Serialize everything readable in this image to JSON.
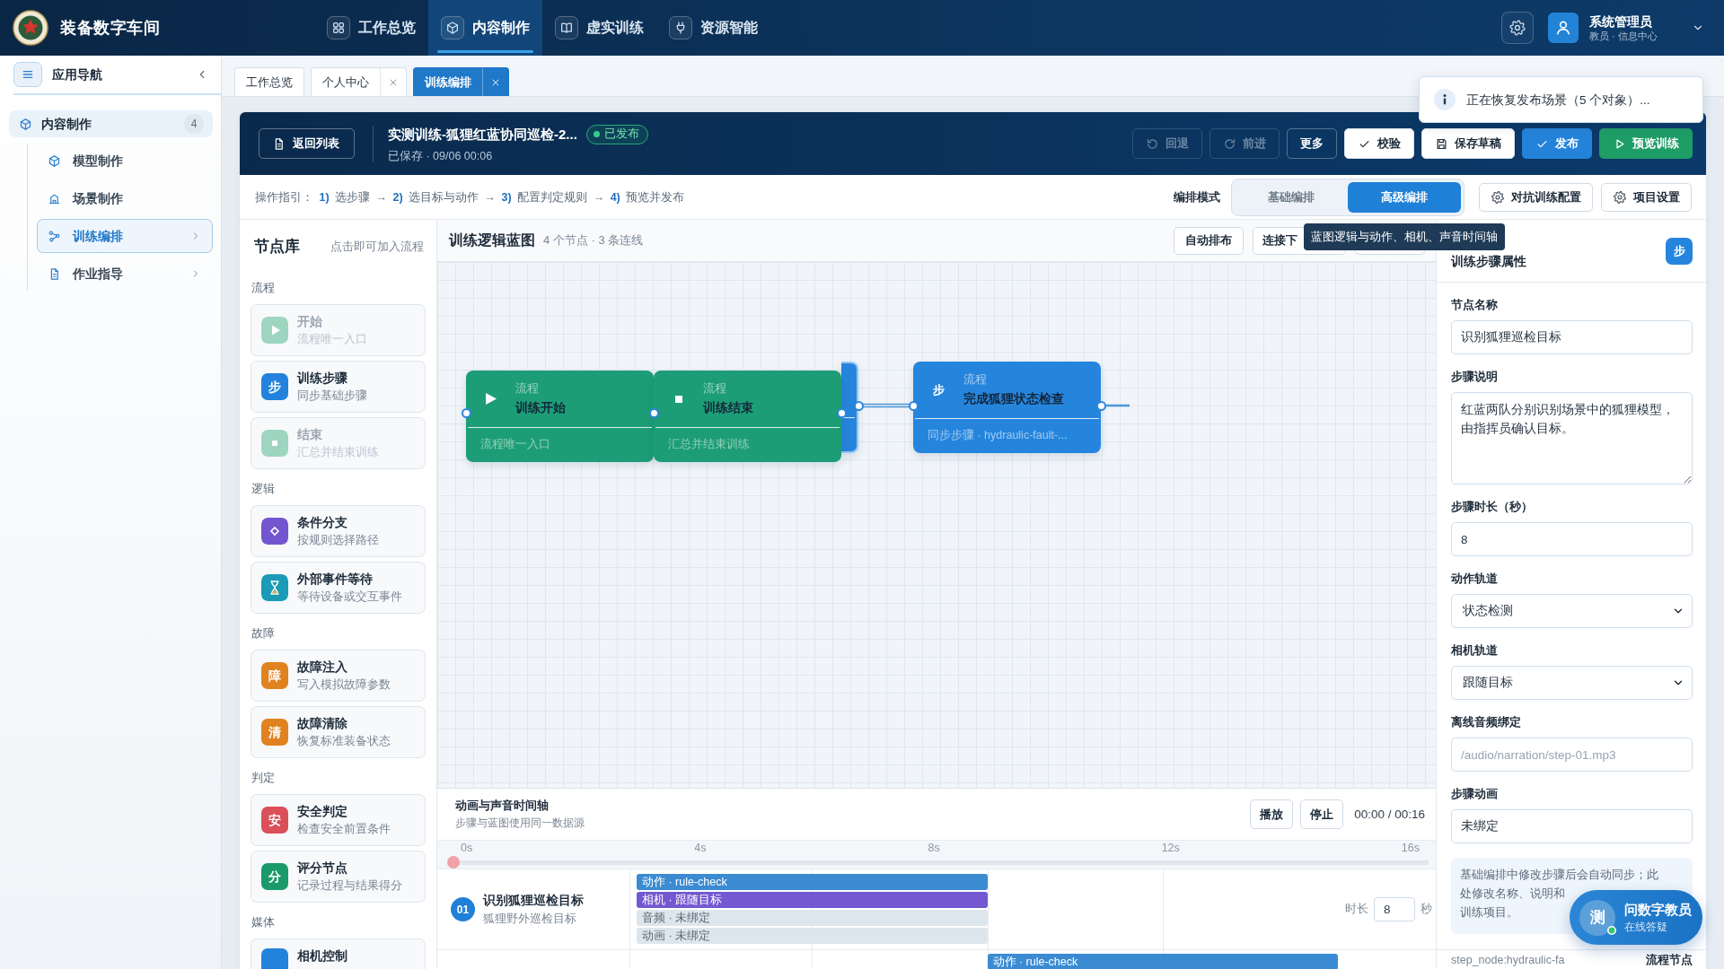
{
  "app": {
    "title": "装备数字车间"
  },
  "nav": [
    {
      "label": "工作总览",
      "selected": false
    },
    {
      "label": "内容制作",
      "selected": true
    },
    {
      "label": "虚实训练",
      "selected": false
    },
    {
      "label": "资源智能",
      "selected": false
    }
  ],
  "user": {
    "name": "系统管理员",
    "role": "教员 · 信息中心"
  },
  "sidebar": {
    "title": "应用导航",
    "items": [
      {
        "label": "内容制作",
        "count": "4",
        "expanded": true,
        "children": [
          {
            "label": "模型制作",
            "kind": "leaf",
            "selected": false
          },
          {
            "label": "场景制作",
            "kind": "leaf",
            "selected": false
          },
          {
            "label": "训练编排",
            "kind": "group",
            "selected": true
          },
          {
            "label": "作业指导",
            "kind": "group",
            "selected": false
          }
        ]
      }
    ]
  },
  "tabs": [
    {
      "label": "工作总览",
      "closable": false,
      "selected": false
    },
    {
      "label": "个人中心",
      "closable": true,
      "selected": false
    },
    {
      "label": "训练编排",
      "closable": true,
      "selected": true
    }
  ],
  "banner": {
    "back_button": "返回列表",
    "title": "实测训练-狐狸红蓝协同巡检-2...",
    "status": "已发布",
    "saved": "已保存 · 09/06 00:06",
    "actions": [
      {
        "label": "回退",
        "kind": "ghost",
        "disabled": true
      },
      {
        "label": "前进",
        "kind": "ghost",
        "disabled": true
      },
      {
        "label": "更多",
        "kind": "ghost",
        "disabled": false
      },
      {
        "label": "校验",
        "kind": "light",
        "disabled": false
      },
      {
        "label": "保存草稿",
        "kind": "light",
        "disabled": false
      },
      {
        "label": "发布",
        "kind": "primary",
        "disabled": false
      },
      {
        "label": "预览训练",
        "kind": "success",
        "disabled": false
      }
    ]
  },
  "toast": {
    "text": "正在恢复发布场景（5 个对象）..."
  },
  "guide": "操作指引： **1)** 选步骤 → **2)** 选目标与动作 → **3)** 配置判定规则 → **4)** 预览并发布",
  "mode": {
    "label": "编排模式",
    "options": [
      {
        "label": "基础编排",
        "selected": false
      },
      {
        "label": "高级编排",
        "selected": true
      }
    ]
  },
  "settings_buttons": [
    "对抗训练配置",
    "项目设置"
  ],
  "tooltip": "蓝图逻辑与动作、相机、声音时间轴",
  "library": {
    "title": "节点库",
    "hint": "点击即可加入流程",
    "sections": [
      {
        "title": "流程",
        "items": [
          {
            "kind": "start",
            "title": "开始",
            "desc": "流程唯一入口",
            "color": "#9dd5c1",
            "disabled": true
          },
          {
            "kind": "step",
            "glyph": "步",
            "title": "训练步骤",
            "desc": "同步基础步骤",
            "color": "#2383dc",
            "disabled": false
          },
          {
            "kind": "end",
            "title": "结束",
            "desc": "汇总并结束训练",
            "color": "#9dd5c1",
            "disabled": true
          }
        ]
      },
      {
        "title": "逻辑",
        "items": [
          {
            "kind": "branch",
            "title": "条件分支",
            "desc": "按规则选择路径",
            "color": "#7455d0",
            "disabled": false
          },
          {
            "kind": "wait",
            "title": "外部事件等待",
            "desc": "等待设备或交互事件",
            "color": "#1b9bb6",
            "disabled": false
          }
        ]
      },
      {
        "title": "故障",
        "items": [
          {
            "kind": "fault",
            "glyph": "障",
            "title": "故障注入",
            "desc": "写入模拟故障参数",
            "color": "#e0821f",
            "disabled": false
          },
          {
            "kind": "clear",
            "glyph": "清",
            "title": "故障清除",
            "desc": "恢复标准装备状态",
            "color": "#e0821f",
            "disabled": false
          }
        ]
      },
      {
        "title": "判定",
        "items": [
          {
            "kind": "safety",
            "glyph": "安",
            "title": "安全判定",
            "desc": "检查安全前置条件",
            "color": "#da4f58",
            "disabled": false
          },
          {
            "kind": "score",
            "glyph": "分",
            "title": "评分节点",
            "desc": "记录过程与结果得分",
            "color": "#1a9a6b",
            "disabled": false
          }
        ]
      },
      {
        "title": "媒体",
        "items": [
          {
            "kind": "camera",
            "title": "相机控制",
            "color": "#2383dc",
            "disabled": false
          }
        ]
      }
    ]
  },
  "canvas": {
    "title": "训练逻辑蓝图",
    "summary": "4 个节点 · 3 条连线",
    "buttons": [
      {
        "kind": "text",
        "label": "自动排布"
      },
      {
        "kind": "text",
        "label": "连接下"
      },
      {
        "kind": "blank"
      }
    ],
    "nodes": [
      {
        "kind": "start",
        "category": "流程",
        "title": "训练开始",
        "footer": "流程唯一入口",
        "selected": false
      },
      {
        "kind": "step",
        "selected": true
      },
      {
        "kind": "end",
        "category": "流程",
        "title": "训练结束",
        "footer": "汇总并结束训练",
        "selected": false
      },
      {
        "kind": "step",
        "glyph": "步",
        "category": "流程",
        "title": "完成狐狸状态检查",
        "footer": "同步步骤 · hydraulic-fault-...",
        "selected": false
      }
    ]
  },
  "timeline": {
    "title": "动画与声音时间轴",
    "subtitle": "步骤与蓝图使用同一数据源",
    "buttons": [
      "播放",
      "停止"
    ],
    "time": "00:00 / 00:16",
    "ticks": [
      "0s",
      "4s",
      "8s",
      "12s",
      "16s"
    ],
    "playhead": {
      "level": 0
    },
    "rows": [
      {
        "number": "01",
        "title": "识别狐狸巡检目标",
        "subtitle": "狐狸野外巡检目标",
        "duration_label": "时长",
        "duration": "8",
        "unit": "秒",
        "bars": [
          {
            "kind": "action",
            "label": "动作 · rule-check"
          },
          {
            "kind": "camera",
            "label": "相机 · 跟随目标"
          },
          {
            "kind": "audio",
            "label": "音频 · 未绑定"
          },
          {
            "kind": "animation",
            "label": "动画 · 未绑定"
          }
        ]
      },
      {
        "bars": [
          {
            "kind": "action",
            "label": "动作 · rule-check"
          }
        ]
      }
    ]
  },
  "properties": {
    "title": "训练步骤属性",
    "badge": "步",
    "fields": [
      {
        "kind": "input",
        "label": "节点名称",
        "value": "识别狐狸巡检目标"
      },
      {
        "kind": "textarea",
        "label": "步骤说明",
        "value": "红蓝两队分别识别场景中的狐狸模型，由指挥员确认目标。"
      },
      {
        "kind": "input",
        "label": "步骤时长（秒）",
        "value": "8"
      },
      {
        "kind": "select",
        "label": "动作轨道",
        "value": "状态检测"
      },
      {
        "kind": "select",
        "label": "相机轨道",
        "value": "跟随目标"
      },
      {
        "kind": "input",
        "label": "离线音频绑定",
        "placeholder": "/audio/narration/step-01.mp3"
      },
      {
        "kind": "input",
        "label": "步骤动画",
        "value": "未绑定"
      }
    ],
    "note": [
      "基础编排中修改步骤后会自动同步；此处修改名称、说明和",
      "训练项目。"
    ],
    "footer": {
      "id": "step_node:hydraulic-fa",
      "type": "流程节点"
    }
  },
  "assistant": {
    "avatar": "测",
    "title": "问数字教员",
    "subtitle": "在线答疑",
    "online": true
  }
}
